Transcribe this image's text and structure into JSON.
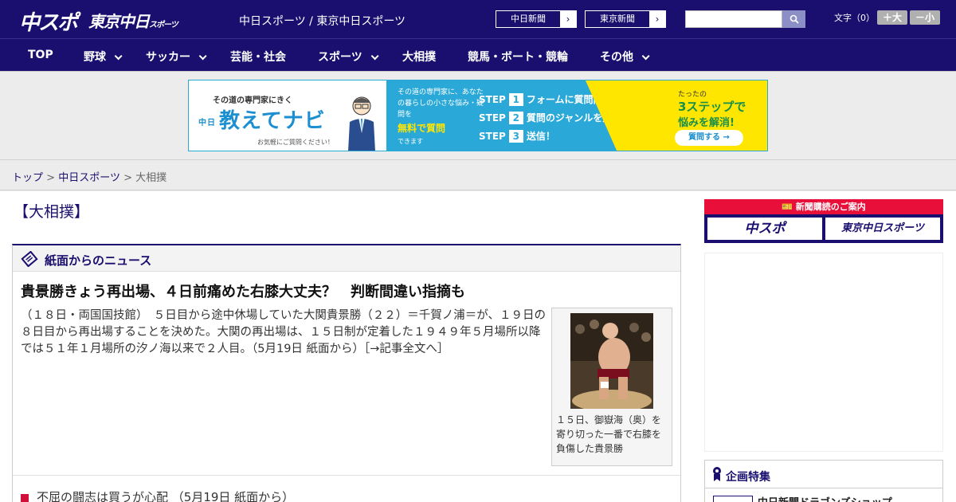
{
  "header": {
    "logo_chuspo": "中スポ",
    "logo_tokyo": "東京中日",
    "logo_tokyo_sub": "スポーツ",
    "site_title": "中日スポーツ / 東京中日スポーツ",
    "chunichi_btn": "中日新聞",
    "tokyo_btn": "東京新聞",
    "search_placeholder": "",
    "font_label": "文字（0）",
    "font_big": "＋大",
    "font_small": "－小"
  },
  "nav": {
    "items": [
      {
        "label": "TOP"
      },
      {
        "label": "野球"
      },
      {
        "label": "サッカー"
      },
      {
        "label": "芸能・社会"
      },
      {
        "label": "スポーツ"
      },
      {
        "label": "大相撲"
      },
      {
        "label": "競馬・ボート・競輪"
      },
      {
        "label": "その他"
      }
    ]
  },
  "banner": {
    "tagline": "その道の専門家にきく",
    "brand_prefix": "中日",
    "brand": "教えてナビ",
    "note": "お気軽にご質問ください！",
    "mid_text": "その道の専門家に、あなたの暮らしの小さな悩み・疑問を",
    "mid_highlight": "無料で質問",
    "mid_end": "できます",
    "step1": "フォームに質問内容を入力",
    "step2": "質問のジャンルを選択",
    "step3": "送信！",
    "step_label": "STEP",
    "right_top": "たったの",
    "right_main": "3ステップで",
    "right_sub": "悩みを解消!",
    "right_cta": "質問する →"
  },
  "breadcrumb": {
    "home": "トップ",
    "sep": ">",
    "section": "中日スポーツ",
    "current": "大相撲"
  },
  "main": {
    "section_title": "【大相撲】",
    "panel_title": "紙面からのニュース",
    "headline": "貴景勝きょう再出場、４日前痛めた右膝大丈夫？　判断間違い指摘も",
    "lead": "（１８日・両国国技館）　５日目から途中休場していた大関貴景勝（２２）＝千賀ノ浦＝が、１９日の８日目から再出場することを決めた。大関の再出場は、１５日制が定着した１９４９年５月場所以降では５１年１月場所の汐ノ海以来で２人目。（5月19日 紙面から）［→記事全文へ］",
    "photo_caption": "１５日、御嶽海（奥）を寄り切った一番で右膝を負傷した貴景勝",
    "list_item": "不屈の闘志は買うが心配 （5月19日 紙面から）"
  },
  "sidebar": {
    "sub_head": "新聞購読のご案内",
    "sub_logo1": "中スポ",
    "sub_logo2": "東京中日スポーツ",
    "feature_title": "企画特集",
    "feature_item": "中日新聞ドラゴンズショップ"
  },
  "colors": {
    "brand_navy": "#1a0f6e",
    "accent_red": "#e8103a",
    "banner_blue": "#2aa8d8",
    "banner_yellow": "#ffe600"
  }
}
